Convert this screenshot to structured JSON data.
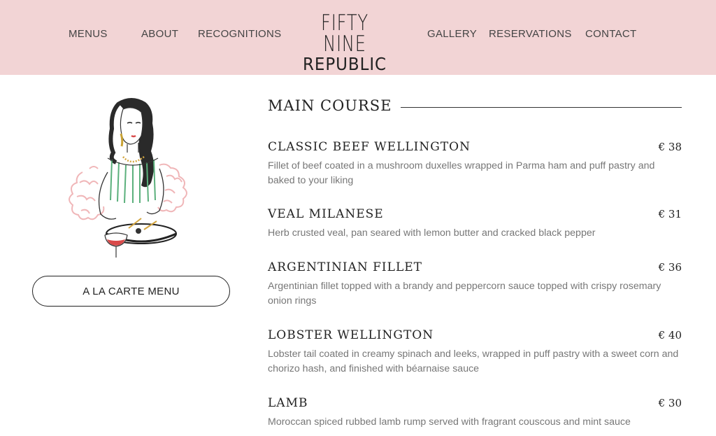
{
  "nav": {
    "left": [
      "MENUS",
      "ABOUT",
      "RECOGNITIONS"
    ],
    "right": [
      "GALLERY",
      "RESERVATIONS",
      "CONTACT"
    ]
  },
  "logo": {
    "top": "FIFTY NINE",
    "bottom": "REPUBLIC"
  },
  "sidebar": {
    "button_label": "A LA CARTE MENU"
  },
  "menu": {
    "section_title": "MAIN COURSE",
    "items": [
      {
        "name": "CLASSIC BEEF WELLINGTON",
        "price": "€ 38",
        "description": "Fillet of beef coated in a mushroom duxelles wrapped in Parma ham and puff pastry and baked to your liking"
      },
      {
        "name": "VEAL MILANESE",
        "price": "€ 31",
        "description": "Herb crusted veal, pan seared with lemon butter and cracked black pepper"
      },
      {
        "name": "ARGENTINIAN FILLET",
        "price": "€ 36",
        "description": "Argentinian fillet topped with a brandy and peppercorn sauce topped with crispy rosemary onion rings"
      },
      {
        "name": "LOBSTER WELLINGTON",
        "price": "€ 40",
        "description": "Lobster tail coated in creamy spinach and leeks, wrapped in puff pastry with a sweet corn and chorizo hash, and finished with béarnaise sauce"
      },
      {
        "name": "LAMB",
        "price": "€ 30",
        "description": "Moroccan spiced rubbed lamb rump served with fragrant couscous and mint sauce"
      }
    ]
  },
  "colors": {
    "header_bg": "#f2d4d5",
    "accent_pink": "#f0b6b8",
    "text_dark": "#222222",
    "text_muted": "#777777"
  }
}
